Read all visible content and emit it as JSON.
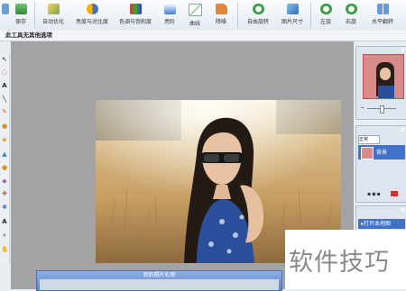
{
  "toolbar": {
    "items": [
      {
        "label": "",
        "icon": "pen-icon"
      },
      {
        "label": "保存",
        "icon": "save-icon"
      },
      {
        "label": "自动优化",
        "icon": "auto-optimize-icon"
      },
      {
        "label": "亮度与对比度",
        "icon": "brightness-contrast-icon"
      },
      {
        "label": "色调与饱和度",
        "icon": "hue-saturation-icon"
      },
      {
        "label": "亮阶",
        "icon": "levels-icon"
      },
      {
        "label": "曲线",
        "icon": "curves-icon"
      },
      {
        "label": "降噪",
        "icon": "denoise-icon"
      },
      {
        "label": "自由旋转",
        "icon": "free-rotate-icon"
      },
      {
        "label": "图片尺寸",
        "icon": "image-size-icon"
      },
      {
        "label": "左旋",
        "icon": "rotate-left-icon"
      },
      {
        "label": "右旋",
        "icon": "rotate-right-icon"
      },
      {
        "label": "水平翻转",
        "icon": "flip-horizontal-icon"
      }
    ]
  },
  "status": {
    "message": "此工具无其他选项"
  },
  "layers": {
    "blend_mode": "正常",
    "layer_name": "背景"
  },
  "history": {
    "action": "打开本地图"
  },
  "bottom_panel": {
    "title": "我的照片礼物"
  },
  "watermark": {
    "text": "软件技巧"
  },
  "colors": {
    "accent": "#4a7bd0",
    "canvas_bg": "#a3a3a3",
    "panel_header": "#5d83c8"
  }
}
